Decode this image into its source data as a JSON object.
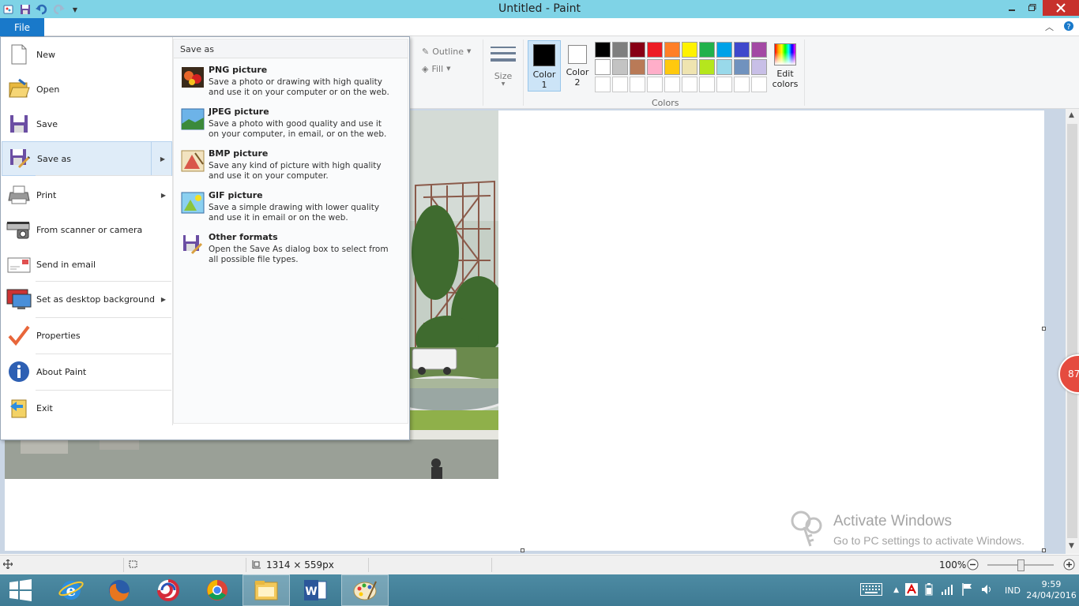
{
  "window": {
    "title": "Untitled - Paint"
  },
  "ribbon": {
    "file_tab": "File",
    "outline_label": "Outline",
    "fill_label": "Fill",
    "size_label": "Size",
    "color1_label_a": "Color",
    "color1_label_b": "1",
    "color2_label_a": "Color",
    "color2_label_b": "2",
    "edit_colors_a": "Edit",
    "edit_colors_b": "colors",
    "colors_group_label": "Colors",
    "color1": "#000000",
    "color2": "#ffffff",
    "palette_row1": [
      "#000000",
      "#7f7f7f",
      "#880015",
      "#ed1c24",
      "#ff7f27",
      "#fff200",
      "#22b14c",
      "#00a2e8",
      "#3f48cc",
      "#a349a4"
    ],
    "palette_row2": [
      "#ffffff",
      "#c3c3c3",
      "#b97a57",
      "#ffaec9",
      "#ffc90e",
      "#efe4b0",
      "#b5e61d",
      "#99d9ea",
      "#7092be",
      "#c8bfe7"
    ]
  },
  "file_menu": {
    "items": [
      {
        "label": "New",
        "icon": "new-document-icon"
      },
      {
        "label": "Open",
        "icon": "open-folder-icon"
      },
      {
        "label": "Save",
        "icon": "floppy-disk-icon"
      },
      {
        "label": "Save as",
        "icon": "save-as-icon"
      },
      {
        "label": "Print",
        "icon": "printer-icon"
      },
      {
        "label": "From scanner or camera",
        "icon": "scanner-icon"
      },
      {
        "label": "Send in email",
        "icon": "email-icon"
      },
      {
        "label": "Set as desktop background",
        "icon": "desktop-icon"
      },
      {
        "label": "Properties",
        "icon": "checkmark-icon"
      },
      {
        "label": "About Paint",
        "icon": "info-icon"
      },
      {
        "label": "Exit",
        "icon": "exit-icon"
      }
    ],
    "save_as_panel": {
      "heading": "Save as",
      "options": [
        {
          "name": "PNG picture",
          "desc1": "Save a photo or drawing with high quality",
          "desc2": "and use it on your computer or on the web."
        },
        {
          "name": "JPEG picture",
          "desc1": "Save a photo with good quality and use it",
          "desc2": "on your computer, in email, or on the web."
        },
        {
          "name": "BMP picture",
          "desc1": "Save any kind of picture with high quality",
          "desc2": "and use it on your computer."
        },
        {
          "name": "GIF picture",
          "desc1": "Save a simple drawing with lower quality",
          "desc2": "and use it in email or on the web."
        },
        {
          "name": "Other formats",
          "desc1": "Open the Save As dialog box to select from",
          "desc2": "all possible file types."
        }
      ]
    }
  },
  "watermark": {
    "line1": "Activate Windows",
    "line2": "Go to PC settings to activate Windows."
  },
  "notification_badge": "87",
  "statusbar": {
    "dimensions": "1314 × 559px",
    "zoom": "100%",
    "zoom_level": 1.0
  },
  "taskbar": {
    "language": "IND",
    "time": "9:59",
    "date": "24/04/2016"
  }
}
